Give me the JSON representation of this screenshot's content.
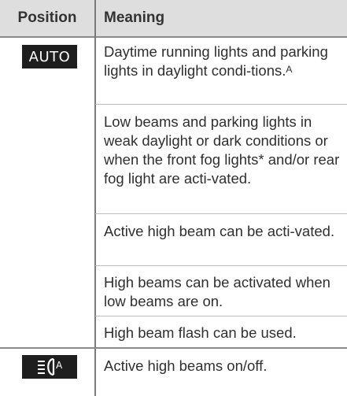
{
  "table": {
    "header": {
      "position": "Position",
      "meaning": "Meaning"
    },
    "rows": [
      {
        "position_badge": "AUTO",
        "position_icon": "active-high-beam-icon",
        "meanings": [
          {
            "text": "Daytime running lights and parking lights in daylight condi-tions.",
            "superscript": "A"
          },
          {
            "text": "Low beams and parking lights in weak daylight or dark conditions or when the front fog lights* and/or rear fog light are acti-vated."
          },
          {
            "text": "Active high beam can be acti-vated."
          },
          {
            "text": "High beams can be activated when low beams are on."
          },
          {
            "text": "High beam flash can be used."
          }
        ]
      },
      {
        "position_icon": "active-high-beam-icon",
        "meanings": [
          {
            "text": "Active high beams on/off."
          }
        ]
      }
    ]
  },
  "colors": {
    "header_bg": "#dedede",
    "badge_bg": "#1e1e1e",
    "badge_text": "#ffffff",
    "text": "#2f2f2f"
  }
}
